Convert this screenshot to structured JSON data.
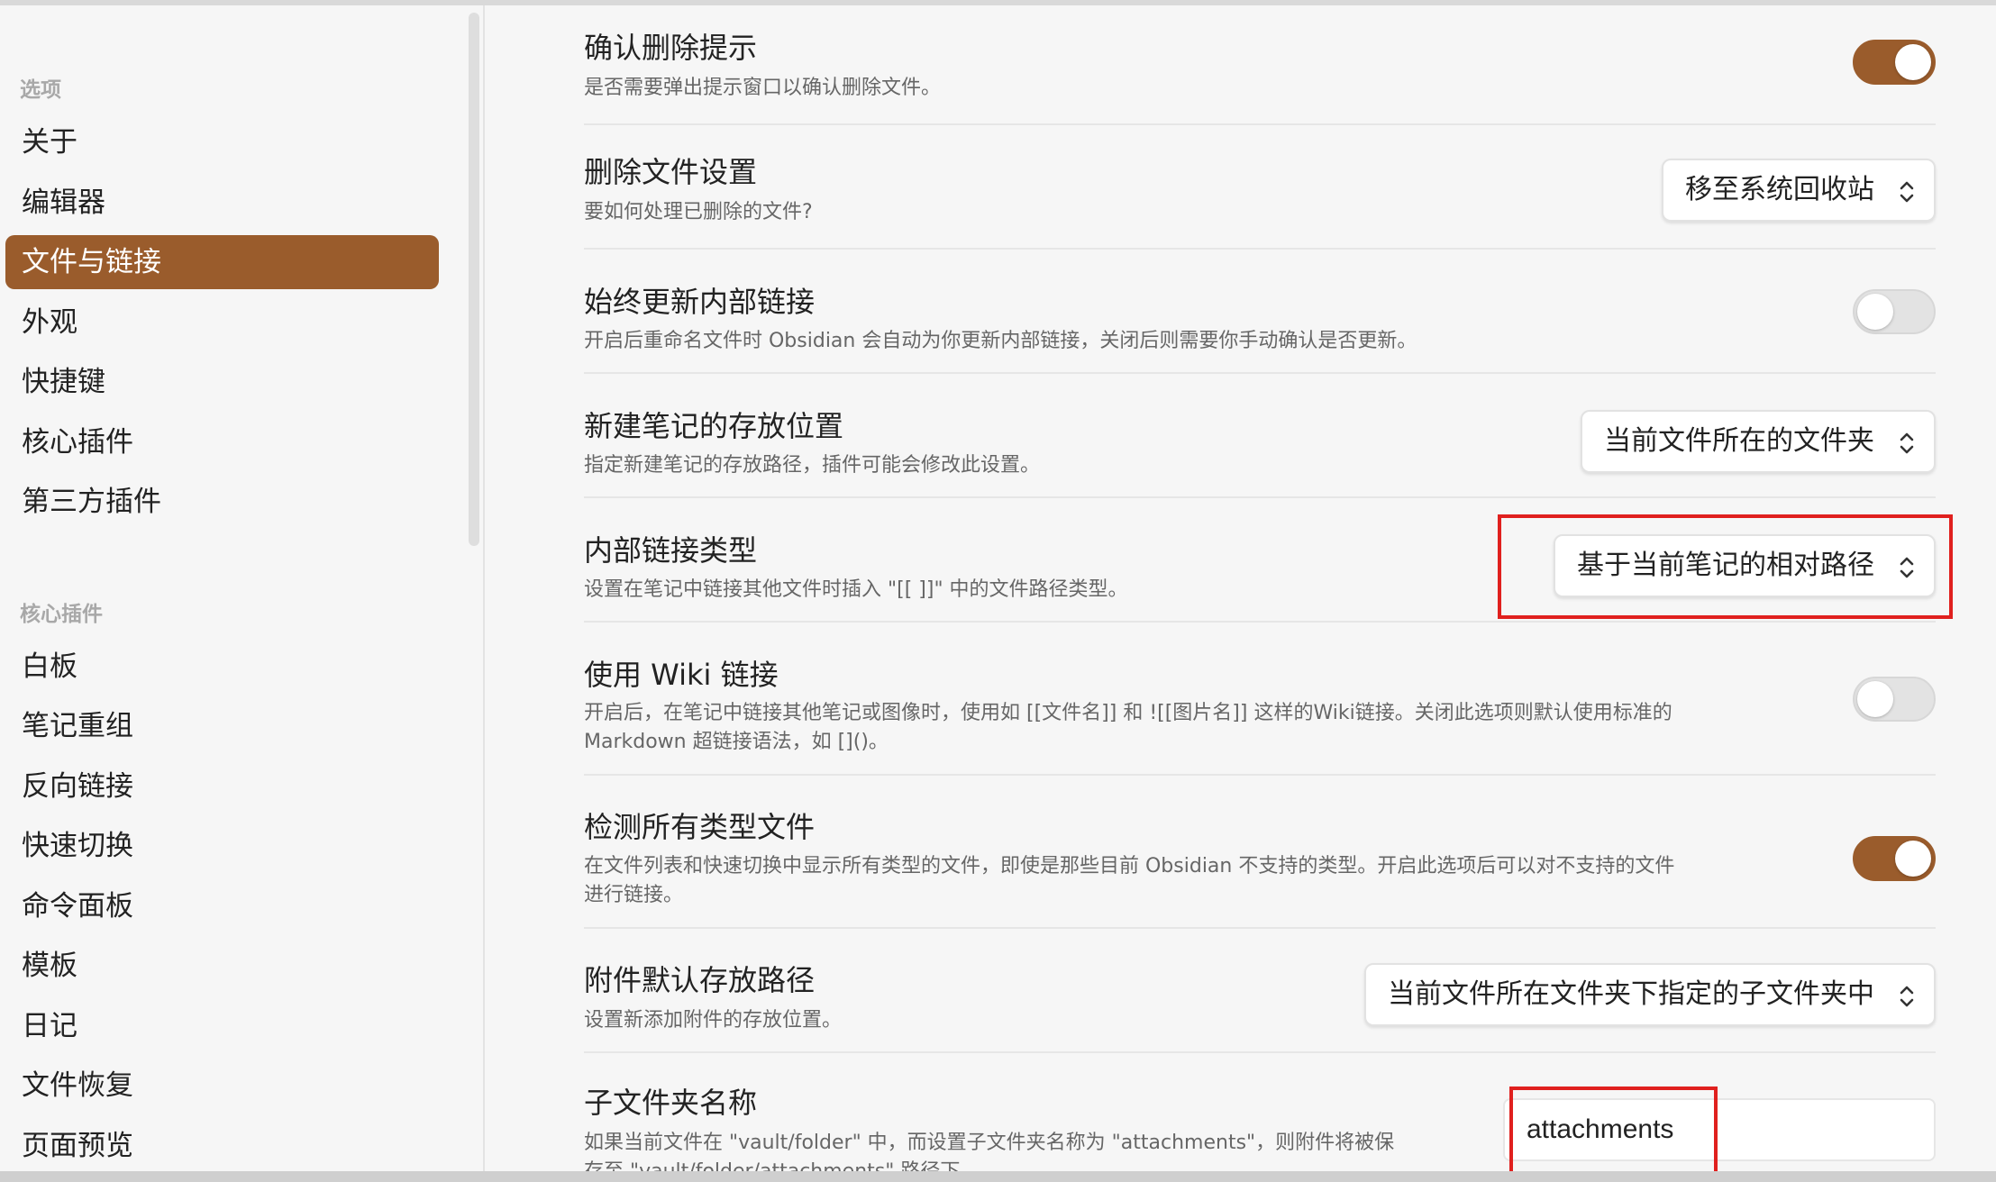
{
  "sidebar": {
    "section_options": "选项",
    "options": [
      {
        "label": "关于"
      },
      {
        "label": "编辑器"
      },
      {
        "label": "文件与链接",
        "active": true
      },
      {
        "label": "外观"
      },
      {
        "label": "快捷键"
      },
      {
        "label": "核心插件"
      },
      {
        "label": "第三方插件"
      }
    ],
    "section_plugins": "核心插件",
    "plugins": [
      {
        "label": "白板"
      },
      {
        "label": "笔记重组"
      },
      {
        "label": "反向链接"
      },
      {
        "label": "快速切换"
      },
      {
        "label": "命令面板"
      },
      {
        "label": "模板"
      },
      {
        "label": "日记"
      },
      {
        "label": "文件恢复"
      },
      {
        "label": "页面预览"
      }
    ]
  },
  "settings": {
    "confirm_delete": {
      "title": "确认删除提示",
      "desc": "是否需要弹出提示窗口以确认删除文件。",
      "enabled": true
    },
    "delete_files": {
      "title": "删除文件设置",
      "desc": "要如何处理已删除的文件?",
      "value": "移至系统回收站"
    },
    "update_links": {
      "title": "始终更新内部链接",
      "desc": "开启后重命名文件时 Obsidian 会自动为你更新内部链接，关闭后则需要你手动确认是否更新。",
      "enabled": false
    },
    "new_note_location": {
      "title": "新建笔记的存放位置",
      "desc": "指定新建笔记的存放路径，插件可能会修改此设置。",
      "value": "当前文件所在的文件夹"
    },
    "link_format": {
      "title": "内部链接类型",
      "desc": "设置在笔记中链接其他文件时插入 \"[[ ]]\" 中的文件路径类型。",
      "value": "基于当前笔记的相对路径"
    },
    "wiki_links": {
      "title": "使用 Wiki 链接",
      "desc_line1": "开启后，在笔记中链接其他笔记或图像时，使用如 [[文件名]] 和 ![[图片名]] 这样的Wiki链接。关闭此选项则默认使用标准的",
      "desc_line2": "Markdown 超链接语法，如 []()。",
      "enabled": false
    },
    "detect_all_files": {
      "title": "检测所有类型文件",
      "desc_line1": "在文件列表和快速切换中显示所有类型的文件，即使是那些目前 Obsidian 不支持的类型。开启此选项后可以对不支持的文件",
      "desc_line2": "进行链接。",
      "enabled": true
    },
    "attachment_location": {
      "title": "附件默认存放路径",
      "desc": "设置新添加附件的存放位置。",
      "value": "当前文件所在文件夹下指定的子文件夹中"
    },
    "subfolder_name": {
      "title": "子文件夹名称",
      "desc_line1": "如果当前文件在 \"vault/folder\" 中，而设置子文件夹名称为 \"attachments\"，则附件将被保",
      "desc_line2": "存至 \"vault/folder/attachments\" 路径下。",
      "value": "attachments"
    }
  },
  "colors": {
    "accent": "#9a5c2c",
    "highlight": "#e0201e"
  }
}
